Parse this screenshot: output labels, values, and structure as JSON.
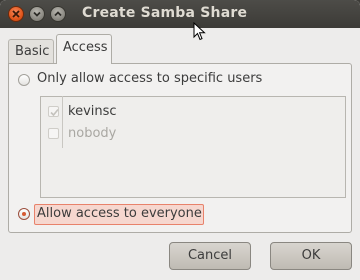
{
  "window": {
    "title": "Create Samba Share",
    "controls": [
      "close-icon",
      "minimize-icon",
      "maximize-icon"
    ]
  },
  "tabs": [
    {
      "label": "Basic",
      "selected": false
    },
    {
      "label": "Access",
      "selected": true
    }
  ],
  "access": {
    "specific_users_label": "Only allow access to specific users",
    "specific_users_selected": false,
    "users": [
      {
        "name": "kevinsc",
        "checked": true,
        "enabled": true
      },
      {
        "name": "nobody",
        "checked": false,
        "enabled": false
      }
    ],
    "everyone_label": "Allow access to everyone",
    "everyone_selected": true
  },
  "buttons": {
    "cancel": "Cancel",
    "ok": "OK"
  },
  "colors": {
    "titlebar": "#3c3b37",
    "accent": "#e1561c",
    "window_bg": "#edeceb"
  }
}
